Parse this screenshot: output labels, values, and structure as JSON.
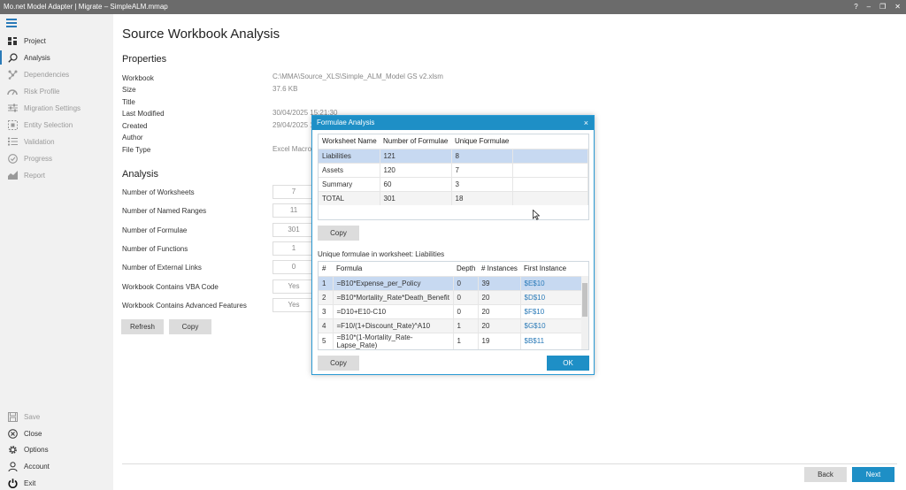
{
  "window": {
    "title": "Mo.net Model Adapter | Migrate – SimpleALM.mmap",
    "controls": [
      "?",
      "–",
      "❐",
      "✕"
    ]
  },
  "sidebar": {
    "items": [
      {
        "label": "Project",
        "icon": "project-icon",
        "state": "enabled"
      },
      {
        "label": "Analysis",
        "icon": "search-icon",
        "state": "active"
      },
      {
        "label": "Dependencies",
        "icon": "dependencies-icon",
        "state": "disabled"
      },
      {
        "label": "Risk Profile",
        "icon": "gauge-icon",
        "state": "disabled"
      },
      {
        "label": "Migration Settings",
        "icon": "sliders-icon",
        "state": "disabled"
      },
      {
        "label": "Entity Selection",
        "icon": "selection-icon",
        "state": "disabled"
      },
      {
        "label": "Validation",
        "icon": "checklist-icon",
        "state": "disabled"
      },
      {
        "label": "Progress",
        "icon": "progress-icon",
        "state": "disabled"
      },
      {
        "label": "Report",
        "icon": "chart-icon",
        "state": "disabled"
      }
    ],
    "bottom": [
      {
        "label": "Save",
        "icon": "save-icon",
        "state": "disabled"
      },
      {
        "label": "Close",
        "icon": "close-circle-icon",
        "state": "enabled"
      },
      {
        "label": "Options",
        "icon": "gear-icon",
        "state": "enabled"
      },
      {
        "label": "Account",
        "icon": "user-icon",
        "state": "enabled"
      },
      {
        "label": "Exit",
        "icon": "power-icon",
        "state": "enabled"
      }
    ]
  },
  "main": {
    "title": "Source Workbook Analysis",
    "properties_heading": "Properties",
    "properties": [
      {
        "label": "Workbook",
        "value": "C:\\MMA\\Source_XLS\\Simple_ALM_Model GS v2.xlsm"
      },
      {
        "label": "Size",
        "value": "37.6 KB"
      },
      {
        "label": "Title",
        "value": ""
      },
      {
        "label": "Last Modified",
        "value": "30/04/2025 15:21:30"
      },
      {
        "label": "Created",
        "value": "29/04/2025 1"
      },
      {
        "label": "Author",
        "value": ""
      },
      {
        "label": "File Type",
        "value": "Excel Macro-"
      }
    ],
    "analysis_heading": "Analysis",
    "analysis": [
      {
        "label": "Number of Worksheets",
        "value": "7"
      },
      {
        "label": "Number of Named Ranges",
        "value": "11"
      },
      {
        "label": "Number of Formulae",
        "value": "301"
      },
      {
        "label": "Number of Functions",
        "value": "1"
      },
      {
        "label": "Number of External Links",
        "value": "0"
      },
      {
        "label": "Workbook Contains VBA Code",
        "value": "Yes"
      },
      {
        "label": "Workbook Contains Advanced Features",
        "value": "Yes"
      }
    ],
    "refresh_label": "Refresh",
    "copy_label": "Copy"
  },
  "footer": {
    "back_label": "Back",
    "next_label": "Next"
  },
  "dialog": {
    "title": "Formulae Analysis",
    "close_glyph": "×",
    "summary_headers": [
      "Worksheet Name",
      "Number of Formulae",
      "Unique Formulae"
    ],
    "summary_rows": [
      [
        "Liabilities",
        "121",
        "8"
      ],
      [
        "Assets",
        "120",
        "7"
      ],
      [
        "Summary",
        "60",
        "3"
      ],
      [
        "TOTAL",
        "301",
        "18"
      ]
    ],
    "copy_label": "Copy",
    "unique_label": "Unique formulae in worksheet: Liabilities",
    "formula_headers": [
      "#",
      "Formula",
      "Depth",
      "# Instances",
      "First Instance"
    ],
    "formula_rows": [
      [
        "1",
        "=B10*Expense_per_Policy",
        "0",
        "39",
        "$E$10"
      ],
      [
        "2",
        "=B10*Mortality_Rate*Death_Benefit",
        "0",
        "20",
        "$D$10"
      ],
      [
        "3",
        "=D10+E10-C10",
        "0",
        "20",
        "$F$10"
      ],
      [
        "4",
        "=F10/(1+Discount_Rate)^A10",
        "1",
        "20",
        "$G$10"
      ],
      [
        "5",
        "=B10*(1-Mortality_Rate-Lapse_Rate)",
        "1",
        "19",
        "$B$11"
      ]
    ],
    "copy2_label": "Copy",
    "ok_label": "OK"
  },
  "colors": {
    "accent": "#1e8fc6",
    "titlebar": "#6b6b6b",
    "sidebar": "#f1f1f1",
    "selection": "#c7d9f1"
  }
}
